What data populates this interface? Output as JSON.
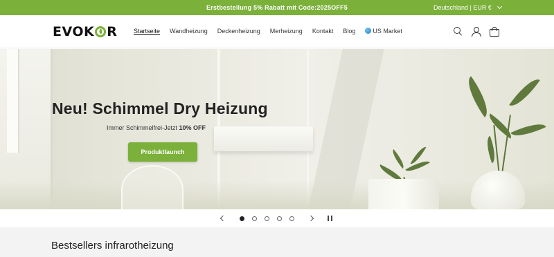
{
  "announcement": {
    "message": "Erstbestellung 5% Rabatt mit Code:2025OFF5",
    "locale": "Deutschland | EUR €",
    "bg_color": "#7bb03a"
  },
  "header": {
    "logo_text_left": "EVOK",
    "logo_text_right": "R",
    "nav": [
      {
        "label": "Startseite",
        "active": true
      },
      {
        "label": "Wandheizung"
      },
      {
        "label": "Deckenheizung"
      },
      {
        "label": "Merheizung"
      },
      {
        "label": "Kontakt"
      },
      {
        "label": "Blog"
      },
      {
        "label": "US Market",
        "icon": "globe-icon"
      }
    ],
    "icons": [
      "search-icon",
      "account-icon",
      "cart-icon"
    ]
  },
  "hero": {
    "title": "Neu! Schimmel Dry Heizung",
    "subtitle_prefix": "Immer Schimmelfrei-Jetzt ",
    "subtitle_bold": "10% OFF",
    "button_label": "Produktlaunch"
  },
  "slider": {
    "slide_count": 5,
    "active_index": 0,
    "icons": [
      "chevron-left-icon",
      "chevron-right-icon",
      "pause-icon"
    ]
  },
  "section": {
    "title": "Bestsellers infrarotheizung"
  },
  "colors": {
    "accent": "#7bb03a",
    "text": "#222222"
  }
}
